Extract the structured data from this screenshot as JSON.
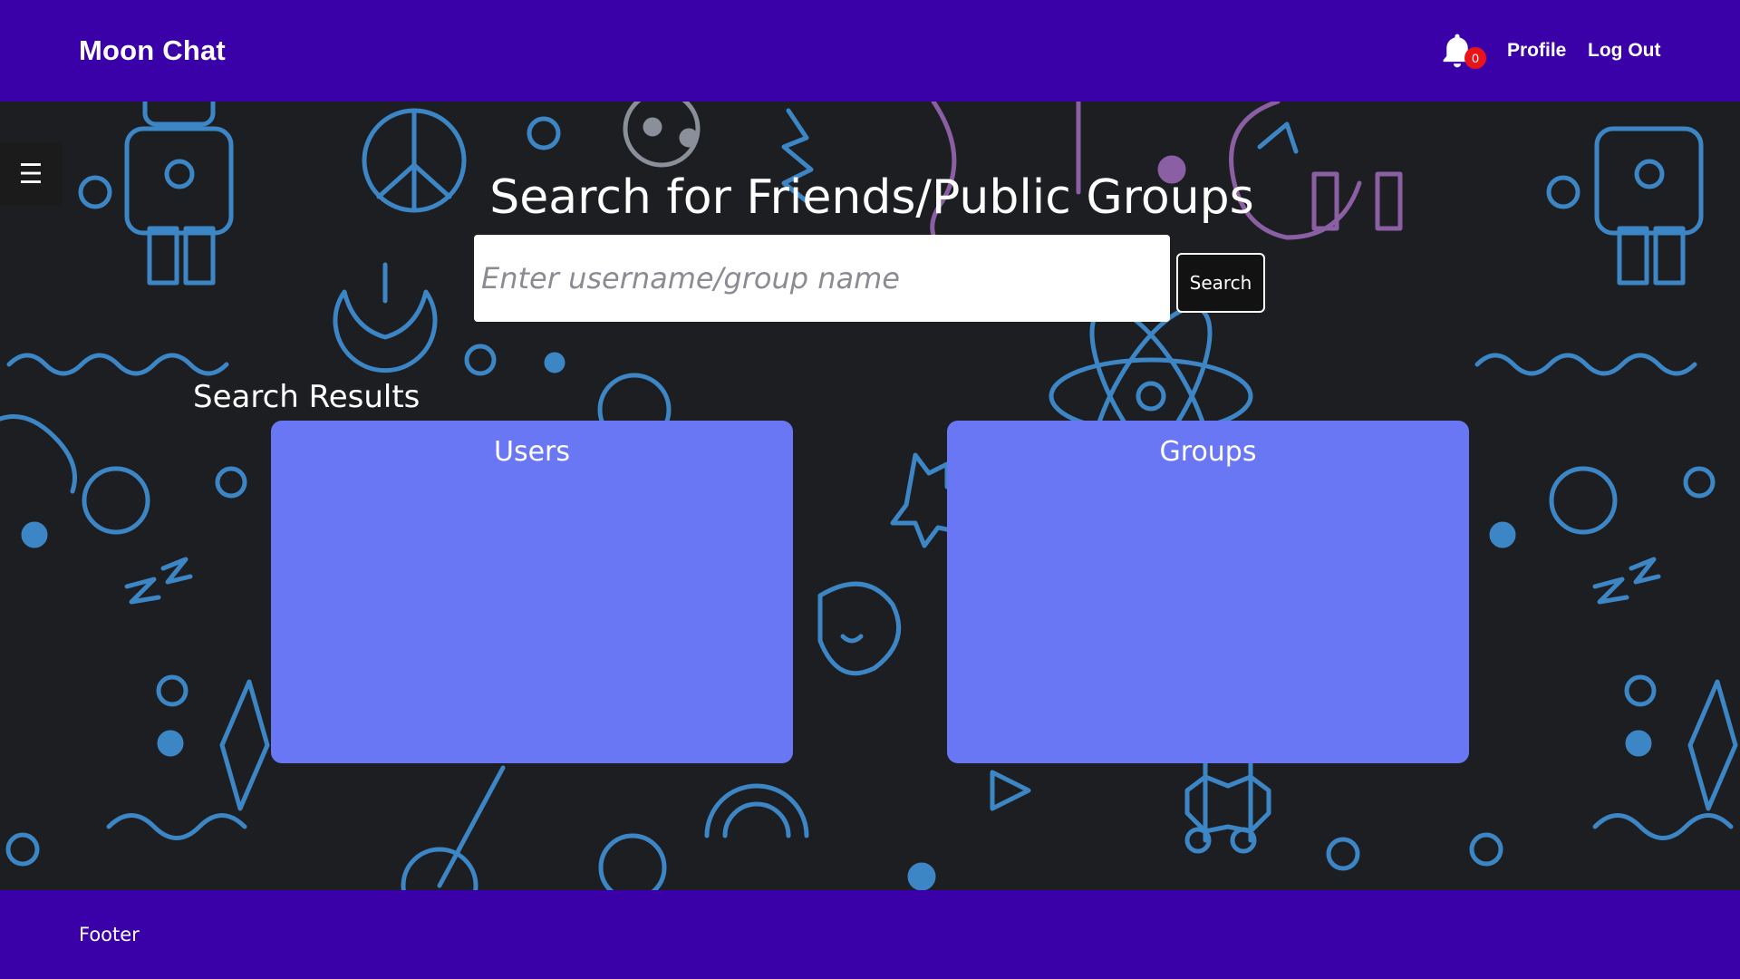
{
  "app": {
    "brand": "Moon Chat"
  },
  "nav": {
    "notification_count": "0",
    "profile_label": "Profile",
    "logout_label": "Log Out",
    "bell_icon": "bell-icon"
  },
  "sidebar": {
    "toggle_glyph": "☰"
  },
  "search": {
    "title": "Search for Friends/Public Groups",
    "placeholder": "Enter username/group name",
    "value": "",
    "button_label": "Search"
  },
  "results": {
    "label": "Search Results",
    "users_title": "Users",
    "groups_title": "Groups",
    "users": [],
    "groups": []
  },
  "footer": {
    "text": "Footer"
  },
  "colors": {
    "navbar": "#3a01a8",
    "panel": "#6a77f5",
    "background": "#1d1e22",
    "badge": "#e8141a",
    "doodle_blue": "#3d86c6",
    "doodle_purple": "#8a5fa3"
  }
}
